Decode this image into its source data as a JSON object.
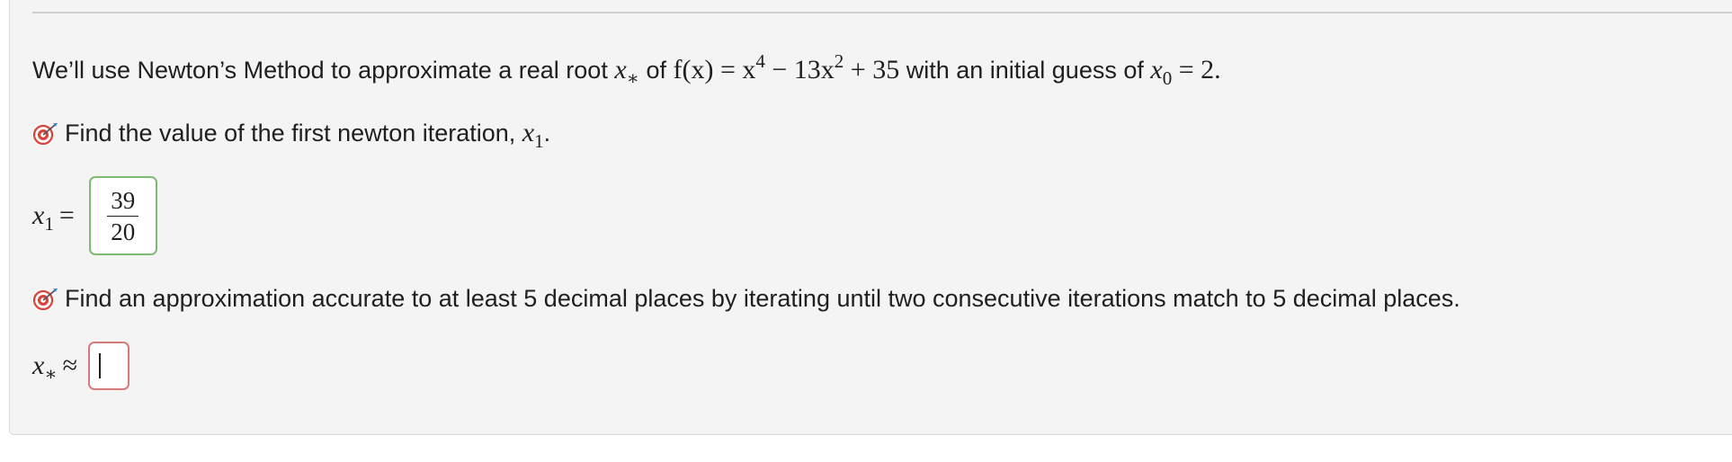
{
  "intro": {
    "text_before": "We’ll use Newton’s Method to approximate a real root ",
    "root_var": "x",
    "root_sub": "∗",
    "text_of": " of ",
    "function_lhs": "f(x) = x",
    "pow4": "4",
    "function_mid": " − 13x",
    "pow2": "2",
    "function_end": " + 35",
    "text_guess": " with an initial guess of ",
    "guess_var": "x",
    "guess_sub": "0",
    "guess_value": " = 2."
  },
  "question1": {
    "text": "Find the value of the first newton iteration, ",
    "var": "x",
    "var_sub": "1",
    "period": ".",
    "icon": "target-icon",
    "answer_var": "x",
    "answer_sub": "1",
    "answer_relation": "=",
    "answer_numerator": "39",
    "answer_denominator": "20",
    "answer_status_color": "#7dbb73"
  },
  "question2": {
    "text": "Find an approximation accurate to at least 5 decimal places by iterating until two consecutive iterations match to 5 decimal places.",
    "icon": "target-icon",
    "answer_var": "x",
    "answer_sub": "∗",
    "answer_relation": "≈",
    "answer_value": "",
    "answer_status_color": "#d67b7b"
  },
  "colors": {
    "panel_background": "#f4f4f4",
    "target_red": "#d9423a"
  }
}
